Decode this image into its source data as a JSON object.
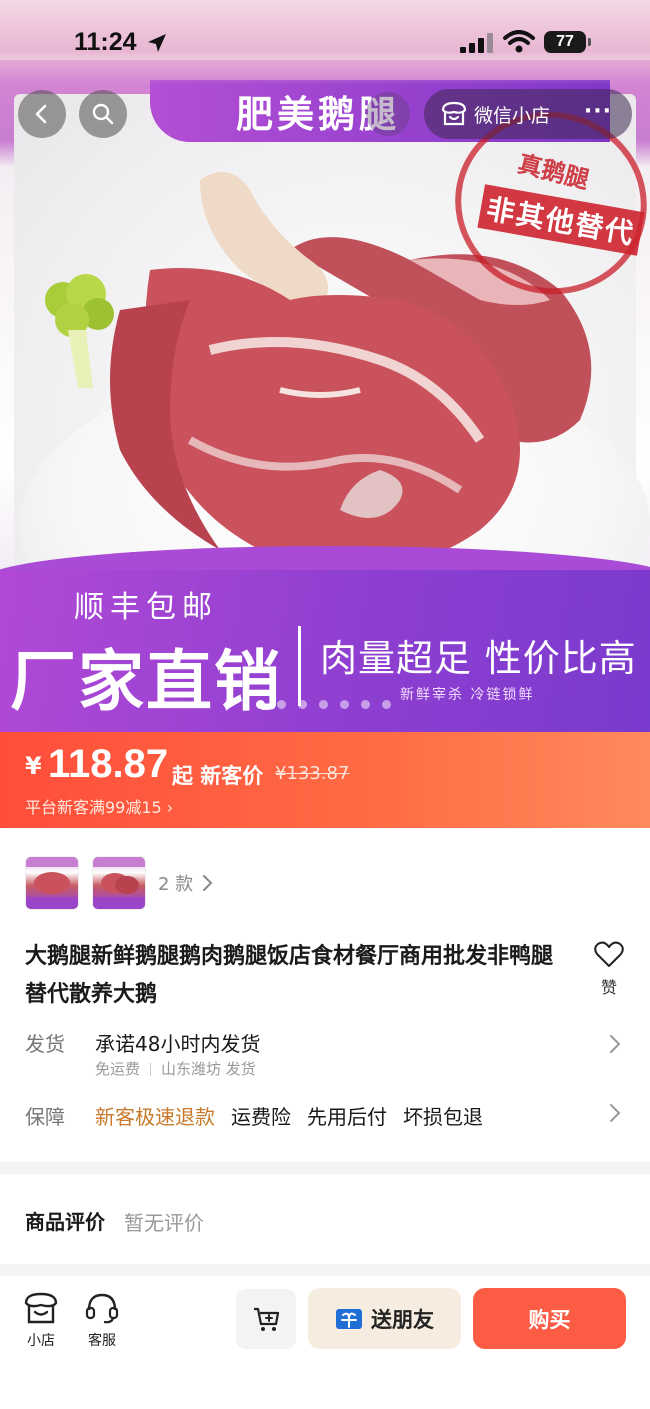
{
  "status_bar": {
    "time": "11:24",
    "battery": "77"
  },
  "nav": {
    "shop_name": "微信小店",
    "more": "···"
  },
  "hero": {
    "title": "肥美鹅腿",
    "stamp_top": "真鹅腿",
    "stamp_main": "非其他替代",
    "shipping": "顺丰包邮",
    "factory": "厂家直销",
    "slogan": "肉量超足 性价比高",
    "fresh": "新鲜宰杀 冷链锁鲜",
    "carousel_count": 7,
    "carousel_index": 1
  },
  "price": {
    "currency": "¥",
    "value": "118.87",
    "suffix": "起 新客价",
    "original": "¥133.87",
    "promo": "平台新客满99减15 ›"
  },
  "variants": {
    "count_label": "2 款"
  },
  "product": {
    "title": "大鹅腿新鲜鹅腿鹅肉鹅腿饭店食材餐厅商用批发非鸭腿替代散养大鹅",
    "like_label": "赞"
  },
  "shipping_row": {
    "label": "发货",
    "main": "承诺48小时内发货",
    "sub1": "免运费",
    "sub2": "山东潍坊 发货"
  },
  "guarantee_row": {
    "label": "保障",
    "tag1": "新客极速退款",
    "tag2": "运费险",
    "tag3": "先用后付",
    "tag4": "坏损包退"
  },
  "reviews": {
    "title": "商品评价",
    "empty": "暂无评价"
  },
  "bottom_bar": {
    "shop_label": "小店",
    "service_label": "客服",
    "gift_label": "送朋友",
    "buy_label": "购买"
  },
  "colors": {
    "accent": "#fc5b44",
    "purple": "#8e3fd1",
    "orange_tag": "#c87a2a"
  }
}
